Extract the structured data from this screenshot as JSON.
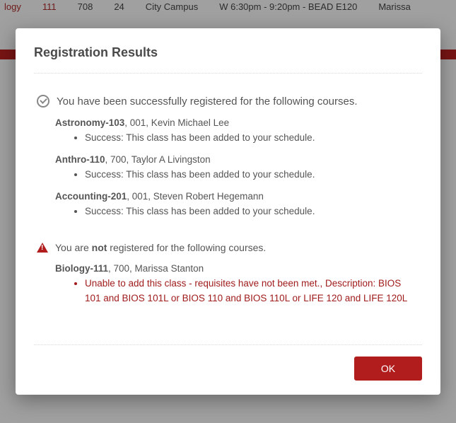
{
  "background": {
    "row1_col1": "logy",
    "row1_col2": "111",
    "row1_col3": "708",
    "row1_col4": "24",
    "row1_col5": "City Campus",
    "row1_col6": "W 6:30pm - 9:20pm - BEAD E120",
    "row1_col7": "Marissa"
  },
  "dialog": {
    "title": "Registration Results",
    "success_intro": "You have been successfully registered for the following courses.",
    "success_courses": [
      {
        "code": "Astronomy-103",
        "rest": ", 001, Kevin Michael Lee",
        "detail": "Success: This class has been added to your schedule."
      },
      {
        "code": "Anthro-110",
        "rest": ", 700, Taylor A Livingston",
        "detail": "Success: This class has been added to your schedule."
      },
      {
        "code": "Accounting-201",
        "rest": ", 001, Steven Robert Hegemann",
        "detail": "Success: This class has been added to your schedule."
      }
    ],
    "fail_intro_1": "You are ",
    "fail_intro_bold": "not",
    "fail_intro_2": " registered for the following courses.",
    "fail_courses": [
      {
        "code": "Biology-111",
        "rest": ", 700, Marissa Stanton",
        "detail": "Unable to add this class - requisites have not been met., Description: BIOS 101 and BIOS 101L or BIOS 110 and BIOS 110L or LIFE 120 and LIFE 120L"
      }
    ],
    "ok_label": "OK"
  }
}
